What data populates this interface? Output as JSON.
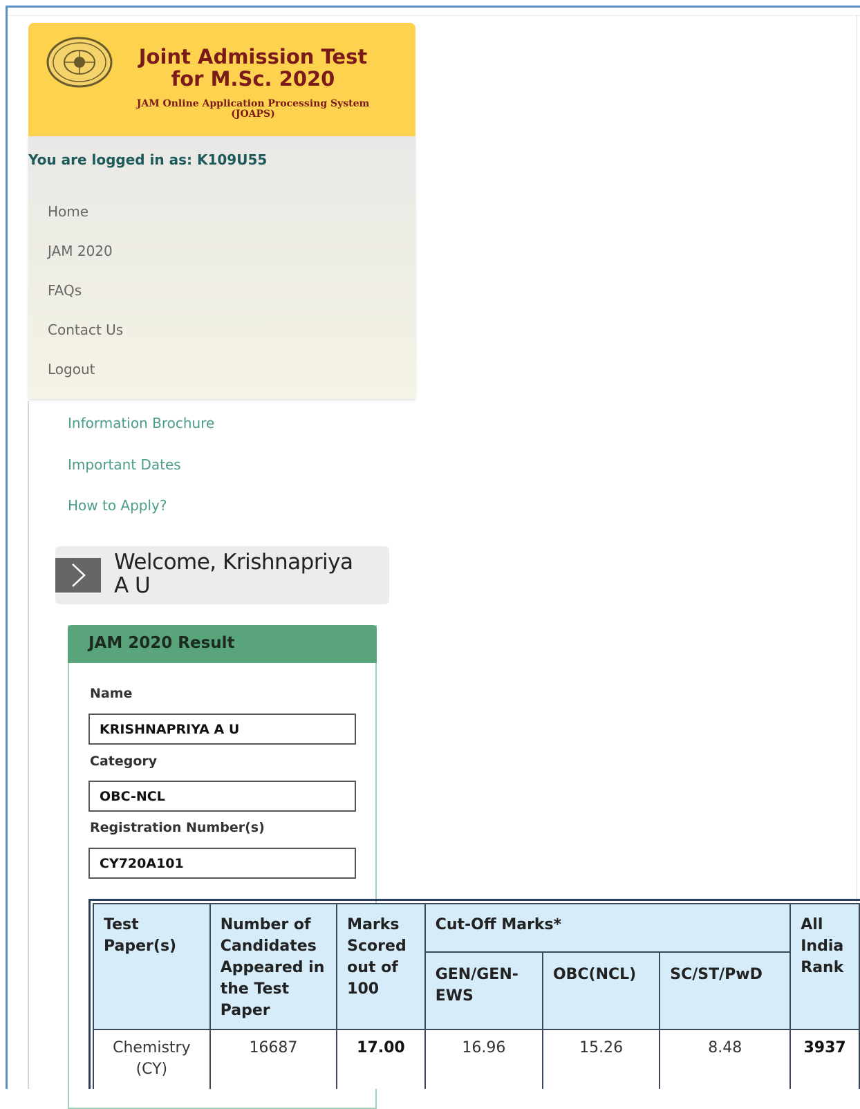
{
  "header": {
    "title_line1": "Joint Admission Test",
    "title_line2": "for M.Sc. 2020",
    "subtitle_line1": "JAM Online Application Processing System",
    "subtitle_line2": "(JOAPS)",
    "logo_icon": "iit-emblem-icon"
  },
  "user": {
    "logged_in_label": "You are logged in as: K109U55"
  },
  "nav": {
    "items": [
      "Home",
      "JAM 2020",
      "FAQs",
      "Contact Us",
      "Logout"
    ]
  },
  "links": {
    "items": [
      "Information Brochure",
      "Important Dates",
      "How to Apply?"
    ]
  },
  "welcome": {
    "line1": "Welcome, Krishnapriya",
    "line2": "A U",
    "icon": "chevron-right-icon"
  },
  "result": {
    "title": "JAM 2020 Result",
    "name_label": "Name",
    "name_value": "KRISHNAPRIYA A U",
    "category_label": "Category",
    "category_value": "OBC-NCL",
    "regno_label": "Registration Number(s)",
    "regno_value": "CY720A101"
  },
  "table": {
    "headers": {
      "test_paper": "Test Paper(s)",
      "candidates": "Number of Candidates Appeared in the Test Paper",
      "marks": "Marks Scored out of 100",
      "cutoff": "Cut-Off Marks*",
      "gen": "GEN/GEN-EWS",
      "obc": "OBC(NCL)",
      "sc": "SC/ST/PwD",
      "rank": "All India Rank"
    },
    "row": {
      "test_paper": "Chemistry (CY)",
      "candidates": "16687",
      "marks": "17.00",
      "gen": "16.96",
      "obc": "15.26",
      "sc": "8.48",
      "rank": "3937"
    }
  },
  "colors": {
    "header_bg": "#fdd24e",
    "header_text": "#7a1a1a",
    "result_head_bg": "#5aa47c",
    "table_head_bg": "#d6ecf9",
    "link_color": "#4a9c88"
  }
}
